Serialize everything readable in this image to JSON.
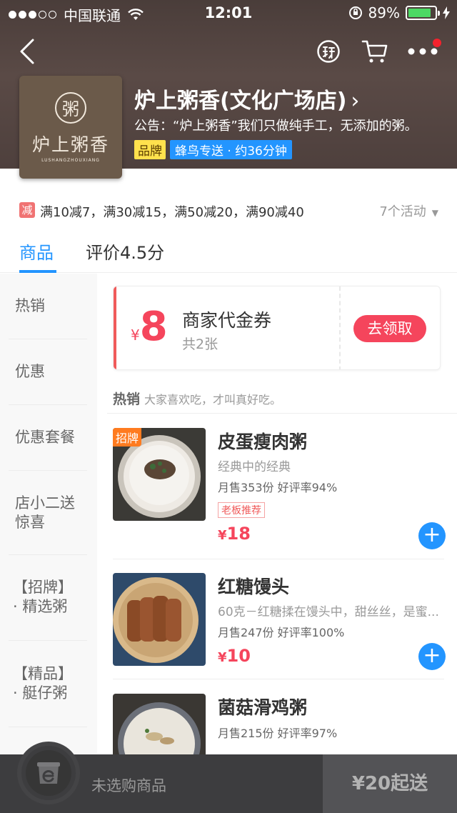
{
  "status_bar": {
    "carrier": "中国联通",
    "time": "12:01",
    "battery": "89%"
  },
  "store": {
    "logo_seal": "粥",
    "logo_text": "炉上粥香",
    "logo_sub": "LUSHANGZHOUXIANG",
    "name": "炉上粥香(文化广场店)",
    "arrow": "›",
    "notice": "公告：“炉上粥香”我们只做纯手工，无添加的粥。",
    "tag_brand": "品牌",
    "tag_delivery": "蜂鸟专送 · 约36分钟"
  },
  "promo": {
    "badge": "减",
    "text": "满10减7，满30减15，满50减20，满90减40",
    "count": "7个活动"
  },
  "tabs": {
    "goods": "商品",
    "reviews": "评价4.5分"
  },
  "categories": [
    {
      "line1": "热销",
      "line2": ""
    },
    {
      "line1": "优惠",
      "line2": ""
    },
    {
      "line1": "优惠套餐",
      "line2": ""
    },
    {
      "line1": "店小二送",
      "line2": "惊喜"
    },
    {
      "line1": "【招牌】",
      "line2": "· 精选粥"
    },
    {
      "line1": "【精品】",
      "line2": "· 艇仔粥"
    }
  ],
  "coupon": {
    "currency": "¥",
    "amount": "8",
    "title": "商家代金券",
    "subtitle": "共2张",
    "button": "去领取"
  },
  "section": {
    "title": "热销",
    "desc": "大家喜欢吃，才叫真好吃。"
  },
  "foods": [
    {
      "badge": "招牌",
      "name": "皮蛋瘦肉粥",
      "desc": "经典中的经典",
      "sales": "月售353份  好评率94%",
      "tag": "老板推荐",
      "currency": "¥",
      "price": "18"
    },
    {
      "badge": "",
      "name": "红糖馒头",
      "desc": "60克－红糖揉在馒头中，甜丝丝，是蜜...",
      "sales": "月售247份  好评率100%",
      "tag": "",
      "currency": "¥",
      "price": "10"
    },
    {
      "badge": "",
      "name": "菌菇滑鸡粥",
      "desc": "",
      "sales": "月售215份  好评率97%",
      "tag": "",
      "currency": "",
      "price": ""
    }
  ],
  "cart": {
    "status": "未选购商品",
    "min_order": "¥20起送"
  },
  "colors": {
    "accent_blue": "#2395ff",
    "price_red": "#f5455c",
    "header_brown": "#4e403d",
    "cart_bar": "#3d3d3f"
  }
}
